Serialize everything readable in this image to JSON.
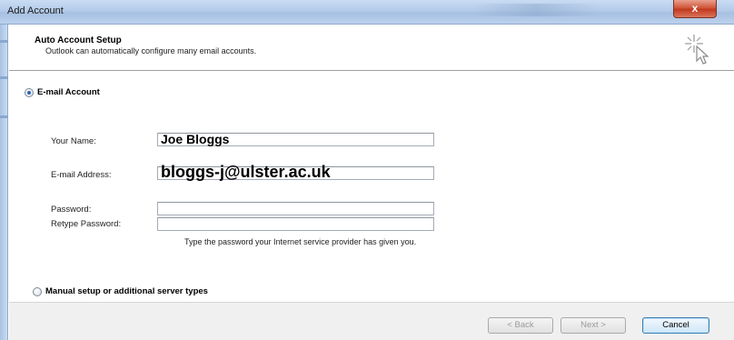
{
  "window": {
    "title": "Add Account",
    "close_label": "x"
  },
  "header": {
    "title": "Auto Account Setup",
    "subtitle": "Outlook can automatically configure many email accounts."
  },
  "email_account": {
    "option_label": "E-mail Account",
    "selected": true,
    "name_label": "Your Name:",
    "name_value": "Joe Bloggs",
    "email_label": "E-mail Address:",
    "email_value": "bloggs-j@ulster.ac.uk",
    "password_label": "Password:",
    "password_value": "",
    "retype_label": "Retype Password:",
    "retype_value": "",
    "password_hint": "Type the password your Internet service provider has given you."
  },
  "manual_setup": {
    "option_label": "Manual setup or additional server types",
    "selected": false
  },
  "buttons": {
    "back": "< Back",
    "next": "Next >",
    "cancel": "Cancel"
  },
  "colors": {
    "title_bar": "#b4cbe9",
    "close_button": "#c23a1f",
    "radio_selected": "#2a66b8",
    "footer": "#f0f0f0"
  }
}
